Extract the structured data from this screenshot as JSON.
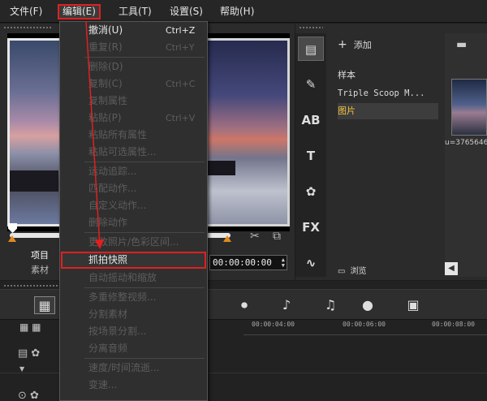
{
  "menubar": {
    "items": [
      "文件(F)",
      "编辑(E)",
      "工具(T)",
      "设置(S)",
      "帮助(H)"
    ]
  },
  "preview": {
    "label_project": "项目",
    "label_clip": "素材",
    "timecode": "00:00:00:00"
  },
  "library": {
    "add_label": "添加",
    "folders": [
      "样本",
      "Triple Scoop M...",
      "图片"
    ],
    "browse_label": "浏览",
    "thumb_caption": "u=3765646"
  },
  "timeline": {
    "ruler_ticks": [
      "00:00:04:00",
      "00:00:06:00",
      "00:00:08:00"
    ]
  },
  "edit_menu": {
    "items": [
      {
        "label": "撤消(U)",
        "shortcut": "Ctrl+Z"
      },
      {
        "label": "重复(R)",
        "shortcut": "Ctrl+Y"
      },
      {
        "label": "删除(D)",
        "shortcut": ""
      },
      {
        "label": "复制(C)",
        "shortcut": "Ctrl+C"
      },
      {
        "label": "复制属性",
        "shortcut": ""
      },
      {
        "label": "粘贴(P)",
        "shortcut": "Ctrl+V"
      },
      {
        "label": "粘贴所有属性",
        "shortcut": ""
      },
      {
        "label": "粘贴可选属性...",
        "shortcut": ""
      },
      {
        "label": "运动追踪...",
        "shortcut": ""
      },
      {
        "label": "匹配动作...",
        "shortcut": ""
      },
      {
        "label": "自定义动作...",
        "shortcut": ""
      },
      {
        "label": "删除动作",
        "shortcut": ""
      },
      {
        "label": "更改照片/色彩区间...",
        "shortcut": ""
      },
      {
        "label": "抓拍快照",
        "shortcut": ""
      },
      {
        "label": "自动摇动和缩放",
        "shortcut": ""
      },
      {
        "label": "多重修整视频...",
        "shortcut": ""
      },
      {
        "label": "分割素材",
        "shortcut": ""
      },
      {
        "label": "按场景分割...",
        "shortcut": ""
      },
      {
        "label": "分离音频",
        "shortcut": ""
      },
      {
        "label": "速度/时间流逝...",
        "shortcut": ""
      },
      {
        "label": "变速...",
        "shortcut": ""
      }
    ]
  },
  "colors": {
    "highlight": "#e02020",
    "marker": "#e08a1e",
    "selected_folder": "#f0c040"
  }
}
